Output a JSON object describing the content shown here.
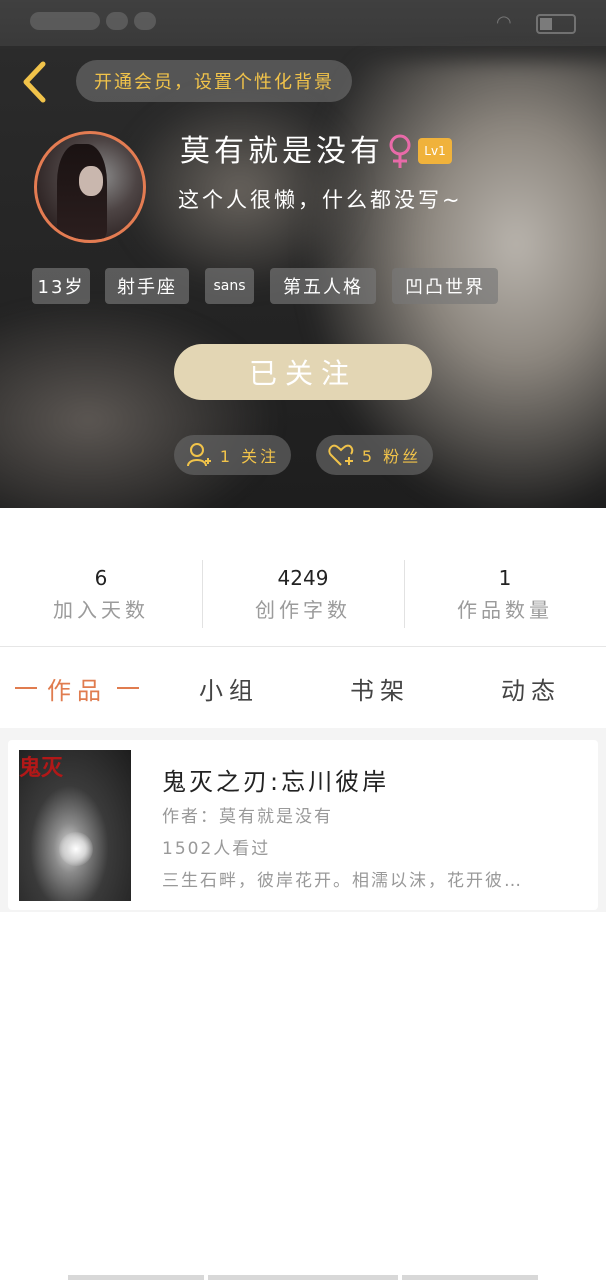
{
  "header": {
    "vip_banner": "开通会员，设置个性化背景",
    "nickname": "莫有就是没有",
    "gender_icon": "female-icon",
    "level_badge": "Lv1",
    "bio": "这个人很懒，什么都没写~",
    "tags": [
      "13岁",
      "射手座",
      "sans",
      "第五人格",
      "凹凸世界"
    ],
    "follow_button_label": "已关注",
    "following_label": "1 关注",
    "fans_label": "5 粉丝",
    "avatar_border_color": "#e47c52",
    "accent_color": "#f1c34a"
  },
  "stats": [
    {
      "value": "6",
      "label": "加入天数"
    },
    {
      "value": "4249",
      "label": "创作字数"
    },
    {
      "value": "1",
      "label": "作品数量"
    }
  ],
  "tabs": [
    {
      "label": "作品",
      "active": true
    },
    {
      "label": "小组",
      "active": false
    },
    {
      "label": "书架",
      "active": false
    },
    {
      "label": "动态",
      "active": false
    }
  ],
  "works": [
    {
      "cover_text": "鬼灭",
      "title": "鬼灭之刃:忘川彼岸",
      "author": "作者：莫有就是没有",
      "views": "1502人看过",
      "description": "三生石畔，彼岸花开。相濡以沫，花开彼…"
    }
  ],
  "colors": {
    "tab_active": "#e07c4f",
    "level_badge": "#f0b23b",
    "follow_button": "#e3d6b4"
  }
}
